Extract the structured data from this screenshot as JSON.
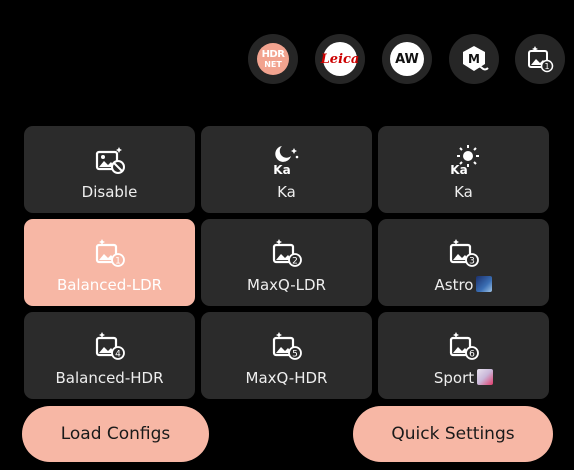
{
  "top_buttons": [
    {
      "name": "hdr-net",
      "line1": "HDR",
      "line2": "NET"
    },
    {
      "name": "leica",
      "text": "Leica"
    },
    {
      "name": "aw",
      "text": "AW"
    },
    {
      "name": "m-mode",
      "text": "M"
    },
    {
      "name": "config-1",
      "badge": "1"
    }
  ],
  "grid": {
    "tiles": [
      {
        "label": "Disable",
        "icon": "image-disable-icon"
      },
      {
        "label": "Ka",
        "icon": "night-ka-icon"
      },
      {
        "label": "Ka",
        "icon": "sun-ka-icon"
      },
      {
        "label": "Balanced-LDR",
        "icon": "config-1-icon",
        "badge": "1",
        "active": true
      },
      {
        "label": "MaxQ-LDR",
        "icon": "config-2-icon",
        "badge": "2"
      },
      {
        "label": "Astro",
        "icon": "config-3-icon",
        "badge": "3",
        "emoji": "milky-way"
      },
      {
        "label": "Balanced-HDR",
        "icon": "config-4-icon",
        "badge": "4"
      },
      {
        "label": "MaxQ-HDR",
        "icon": "config-5-icon",
        "badge": "5"
      },
      {
        "label": "Sport",
        "icon": "config-6-icon",
        "badge": "6",
        "emoji": "runner"
      }
    ]
  },
  "buttons": {
    "load_configs": "Load Configs",
    "quick_settings": "Quick Settings"
  },
  "colors": {
    "accent": "#f7b7a5",
    "tile": "#2b2b2b",
    "background": "#000000"
  }
}
